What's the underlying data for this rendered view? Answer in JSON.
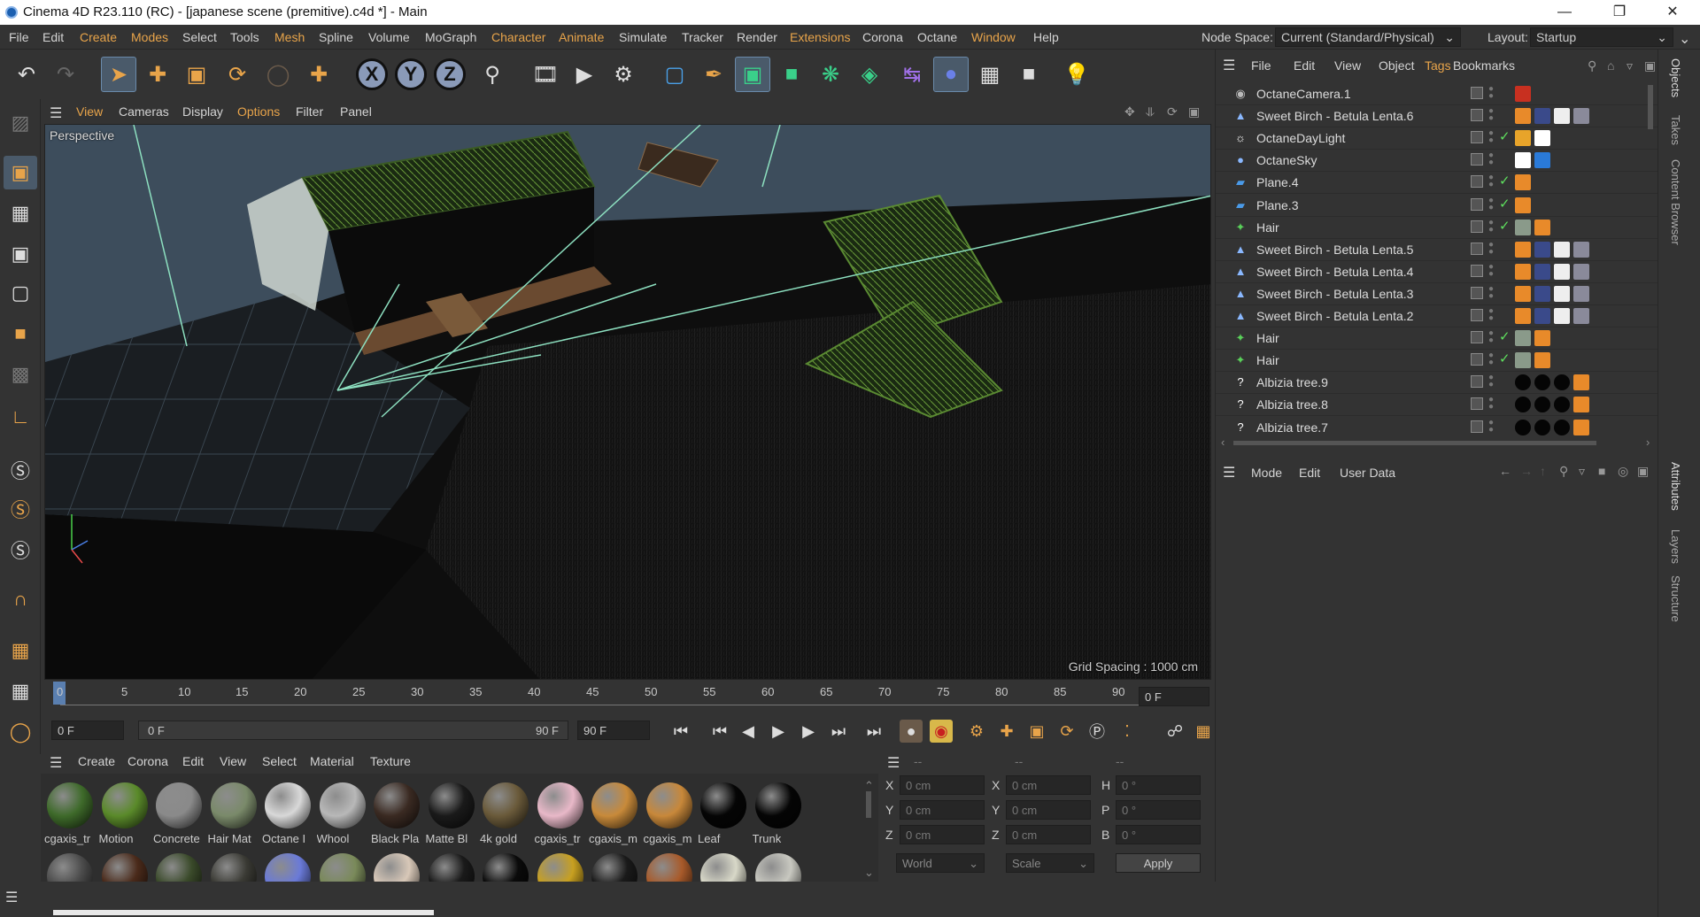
{
  "window": {
    "title": "Cinema 4D R23.110 (RC) - [japanese scene (premitive).c4d *] - Main",
    "controls": [
      "minimize-icon",
      "restore-icon",
      "close-icon"
    ]
  },
  "menubar": {
    "items": [
      "File",
      "Edit",
      "Create",
      "Modes",
      "Select",
      "Tools",
      "Mesh",
      "Spline",
      "Volume",
      "MoGraph",
      "Character",
      "Animate",
      "Simulate",
      "Tracker",
      "Render",
      "Extensions",
      "Corona",
      "Octane",
      "Window",
      "Help"
    ],
    "node_space_label": "Node Space:",
    "node_space_value": "Current (Standard/Physical)",
    "layout_label": "Layout:",
    "layout_value": "Startup"
  },
  "viewport": {
    "menu": [
      "View",
      "Cameras",
      "Display",
      "Options",
      "Filter",
      "Panel"
    ],
    "label": "Perspective",
    "grid_spacing": "Grid Spacing : 1000 cm"
  },
  "timeline": {
    "ticks": [
      "0",
      "5",
      "10",
      "15",
      "20",
      "25",
      "30",
      "35",
      "40",
      "45",
      "50",
      "55",
      "60",
      "65",
      "70",
      "75",
      "80",
      "85",
      "90"
    ],
    "current_frame": "0 F"
  },
  "transport": {
    "start_frame": "0 F",
    "range_start": "0 F",
    "range_end": "90 F",
    "end_frame": "90 F"
  },
  "material_manager": {
    "menu": [
      "Create",
      "Corona",
      "Edit",
      "View",
      "Select",
      "Material",
      "Texture"
    ],
    "materials": [
      {
        "name": "cgaxis_tr",
        "color": "#3e6a2a"
      },
      {
        "name": "Motion",
        "color": "#5a8a2a"
      },
      {
        "name": "Concrete",
        "color": "#8a8a8a"
      },
      {
        "name": "Hair Mat",
        "color": "#7a8a6a"
      },
      {
        "name": "Octane I",
        "color": "#d8d8d8"
      },
      {
        "name": "Whool",
        "color": "#b8b8b8"
      },
      {
        "name": "Black Pla",
        "color": "#3a2a22"
      },
      {
        "name": "Matte Bl",
        "color": "#1a1a1a"
      },
      {
        "name": "4k gold",
        "color": "#6a5a3a"
      },
      {
        "name": "cgaxis_tr",
        "color": "#e8b8c8"
      },
      {
        "name": "cgaxis_m",
        "color": "#c88a3a"
      },
      {
        "name": "cgaxis_m",
        "color": "#c8883a"
      },
      {
        "name": "Leaf",
        "color": "#050505"
      },
      {
        "name": "Trunk",
        "color": "#050505"
      }
    ],
    "row2_colors": [
      "#4a4a4a",
      "#4a2a1a",
      "#3a4a2a",
      "#3a3a34",
      "#6a7ad8",
      "#7a8a5a",
      "#d8c8b8",
      "#1a1a1a",
      "#0a0a0a",
      "#c8a020",
      "#1a1a1a",
      "#a85a2a",
      "#d8d8c8",
      "#c8c8c0"
    ]
  },
  "coordinates": {
    "headers": [
      "--",
      "--",
      "--"
    ],
    "rows": [
      {
        "l1": "X",
        "v1": "0 cm",
        "l2": "X",
        "v2": "0 cm",
        "l3": "H",
        "v3": "0 °"
      },
      {
        "l1": "Y",
        "v1": "0 cm",
        "l2": "Y",
        "v2": "0 cm",
        "l3": "P",
        "v3": "0 °"
      },
      {
        "l1": "Z",
        "v1": "0 cm",
        "l2": "Z",
        "v2": "0 cm",
        "l3": "B",
        "v3": "0 °"
      }
    ],
    "world": "World",
    "scale": "Scale",
    "apply": "Apply"
  },
  "object_manager": {
    "menu": [
      "File",
      "Edit",
      "View",
      "Object",
      "Tags",
      "Bookmarks"
    ],
    "objects": [
      {
        "name": "OctaneCamera.1",
        "icon": "camera-icon",
        "checked": false
      },
      {
        "name": "Sweet Birch - Betula Lenta.6",
        "icon": "tree-icon",
        "checked": false
      },
      {
        "name": "OctaneDayLight",
        "icon": "daylight-icon",
        "checked": true
      },
      {
        "name": "OctaneSky",
        "icon": "sky-icon",
        "checked": false
      },
      {
        "name": "Plane.4",
        "icon": "plane-icon",
        "checked": true
      },
      {
        "name": "Plane.3",
        "icon": "plane-icon",
        "checked": true
      },
      {
        "name": "Hair",
        "icon": "hair-icon",
        "checked": true
      },
      {
        "name": "Sweet Birch - Betula Lenta.5",
        "icon": "tree-icon",
        "checked": false
      },
      {
        "name": "Sweet Birch - Betula Lenta.4",
        "icon": "tree-icon",
        "checked": false
      },
      {
        "name": "Sweet Birch - Betula Lenta.3",
        "icon": "tree-icon",
        "checked": false
      },
      {
        "name": "Sweet Birch - Betula Lenta.2",
        "icon": "tree-icon",
        "checked": false
      },
      {
        "name": "Hair",
        "icon": "hair-icon",
        "checked": true
      },
      {
        "name": "Hair",
        "icon": "hair-icon",
        "checked": true
      },
      {
        "name": "Albizia tree.9",
        "icon": "unknown-icon",
        "checked": false
      },
      {
        "name": "Albizia tree.8",
        "icon": "unknown-icon",
        "checked": false
      },
      {
        "name": "Albizia tree.7",
        "icon": "unknown-icon",
        "checked": false
      }
    ]
  },
  "attribute_manager": {
    "menu": [
      "Mode",
      "Edit",
      "User Data"
    ]
  },
  "right_tabs": {
    "top": [
      "Objects",
      "Takes",
      "Content Browser"
    ],
    "bottom": [
      "Attributes",
      "Layers",
      "Structure"
    ]
  },
  "colors": {
    "accent": "#e8a44a",
    "panel": "#333333",
    "check": "#5ee05e"
  }
}
